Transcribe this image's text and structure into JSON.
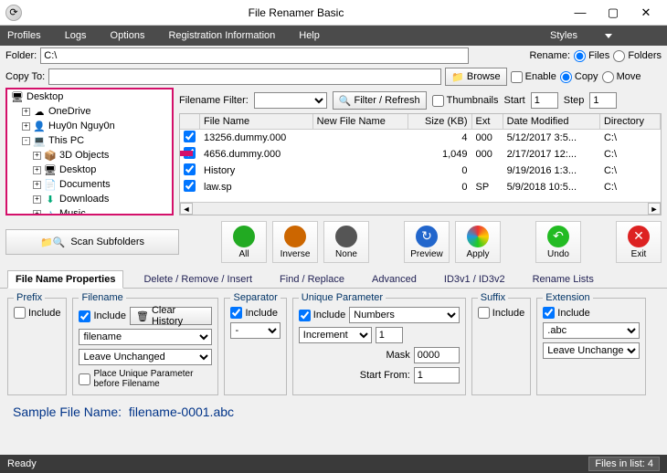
{
  "title": "File Renamer Basic",
  "menu": {
    "profiles": "Profiles",
    "logs": "Logs",
    "options": "Options",
    "reg": "Registration Information",
    "help": "Help",
    "styles": "Styles"
  },
  "labels": {
    "folder": "Folder:",
    "copyto": "Copy To:",
    "browse": "Browse",
    "rename": "Rename:",
    "files": "Files",
    "folders": "Folders",
    "enable": "Enable",
    "copy": "Copy",
    "move": "Move",
    "filenamefilter": "Filename Filter:",
    "filterrefresh": "Filter / Refresh",
    "thumbnails": "Thumbnails",
    "start": "Start",
    "step": "Step",
    "scan": "Scan Subfolders"
  },
  "paths": {
    "folder": "C:\\",
    "copyto": ""
  },
  "spinners": {
    "start": "1",
    "step": "1"
  },
  "tree": {
    "root": "Desktop",
    "items": [
      {
        "exp": "+",
        "icon": "☁",
        "label": "OneDrive"
      },
      {
        "exp": "+",
        "icon": "👤",
        "label": "Huy0n Nguy0n"
      },
      {
        "exp": "-",
        "icon": "💻",
        "label": "This PC",
        "children": [
          {
            "exp": "+",
            "icon": "📦",
            "label": "3D Objects"
          },
          {
            "exp": "+",
            "icon": "🖥",
            "label": "Desktop"
          },
          {
            "exp": "+",
            "icon": "📄",
            "label": "Documents"
          },
          {
            "exp": "+",
            "icon": "⬇",
            "label": "Downloads"
          },
          {
            "exp": "+",
            "icon": "♪",
            "label": "Music"
          }
        ]
      }
    ]
  },
  "cols": {
    "c": "",
    "fn": "File Name",
    "nfn": "New File Name",
    "sz": "Size (KB)",
    "ext": "Ext",
    "dm": "Date Modified",
    "dir": "Directory"
  },
  "rows": [
    {
      "fn": "13256.dummy.000",
      "sz": "4",
      "ext": "000",
      "dm": "5/12/2017 3:5...",
      "dir": "C:\\"
    },
    {
      "fn": "4656.dummy.000",
      "sz": "1,049",
      "ext": "000",
      "dm": "2/17/2017 12:...",
      "dir": "C:\\"
    },
    {
      "fn": "History",
      "sz": "0",
      "ext": "",
      "dm": "9/19/2016 1:3...",
      "dir": "C:\\"
    },
    {
      "fn": "law.sp",
      "sz": "0",
      "ext": "SP",
      "dm": "5/9/2018 10:5...",
      "dir": "C:\\"
    }
  ],
  "big": {
    "all": "All",
    "inverse": "Inverse",
    "none": "None",
    "preview": "Preview",
    "apply": "Apply",
    "undo": "Undo",
    "exit": "Exit"
  },
  "tabs": [
    "File Name Properties",
    "Delete / Remove / Insert",
    "Find / Replace",
    "Advanced",
    "ID3v1 / ID3v2",
    "Rename Lists"
  ],
  "g": {
    "prefix": "Prefix",
    "filename": "Filename",
    "separator": "Separator",
    "unique": "Unique Parameter",
    "suffix": "Suffix",
    "extension": "Extension",
    "include": "Include",
    "clearhist": "Clear History",
    "filenameOpt": "filename",
    "leave": "Leave Unchanged",
    "sep": "-",
    "numbers": "Numbers",
    "increment": "Increment",
    "one": "1",
    "mask": "Mask",
    "maskv": "0000",
    "startfrom": "Start From:",
    "sf": "1",
    "place": "Place Unique Parameter before Filename",
    "abc": ".abc"
  },
  "sample": {
    "label": "Sample File Name:",
    "value": "filename-0001.abc"
  },
  "status": {
    "ready": "Ready",
    "files": "Files in list: 4"
  }
}
